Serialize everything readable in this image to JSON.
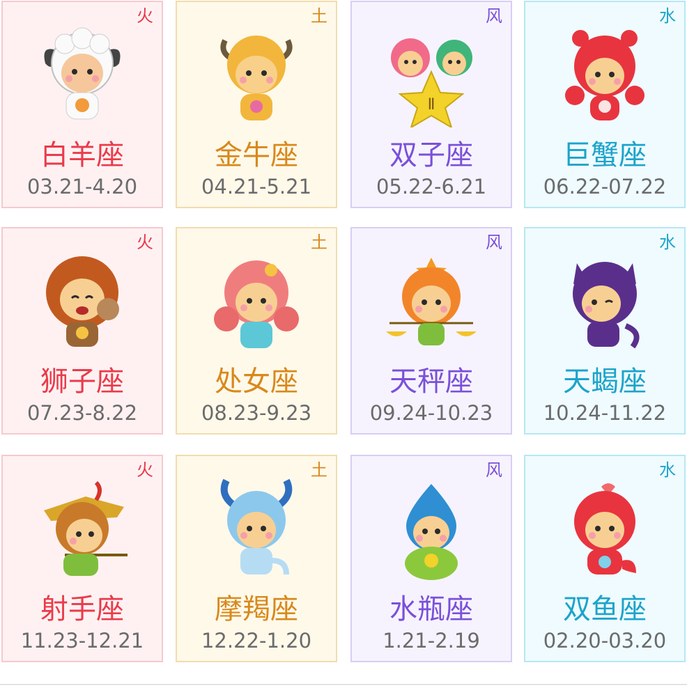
{
  "signs": [
    {
      "name": "白羊座",
      "dates": "03.21-4.20",
      "element": "火",
      "icon": "aries-character-icon"
    },
    {
      "name": "金牛座",
      "dates": "04.21-5.21",
      "element": "土",
      "icon": "taurus-character-icon"
    },
    {
      "name": "双子座",
      "dates": "05.22-6.21",
      "element": "风",
      "icon": "gemini-character-icon"
    },
    {
      "name": "巨蟹座",
      "dates": "06.22-07.22",
      "element": "水",
      "icon": "cancer-character-icon"
    },
    {
      "name": "狮子座",
      "dates": "07.23-8.22",
      "element": "火",
      "icon": "leo-character-icon"
    },
    {
      "name": "处女座",
      "dates": "08.23-9.23",
      "element": "土",
      "icon": "virgo-character-icon"
    },
    {
      "name": "天秤座",
      "dates": "09.24-10.23",
      "element": "风",
      "icon": "libra-character-icon"
    },
    {
      "name": "天蝎座",
      "dates": "10.24-11.22",
      "element": "水",
      "icon": "scorpio-character-icon"
    },
    {
      "name": "射手座",
      "dates": "11.23-12.21",
      "element": "火",
      "icon": "sagittarius-character-icon"
    },
    {
      "name": "摩羯座",
      "dates": "12.22-1.20",
      "element": "土",
      "icon": "capricorn-character-icon"
    },
    {
      "name": "水瓶座",
      "dates": "1.21-2.19",
      "element": "风",
      "icon": "aquarius-character-icon"
    },
    {
      "name": "双鱼座",
      "dates": "02.20-03.20",
      "element": "水",
      "icon": "pisces-character-icon"
    }
  ],
  "colors": {
    "fire": "#ea3b4a",
    "earth": "#d8891b",
    "air": "#7b50d9",
    "water": "#1ca4cb"
  }
}
